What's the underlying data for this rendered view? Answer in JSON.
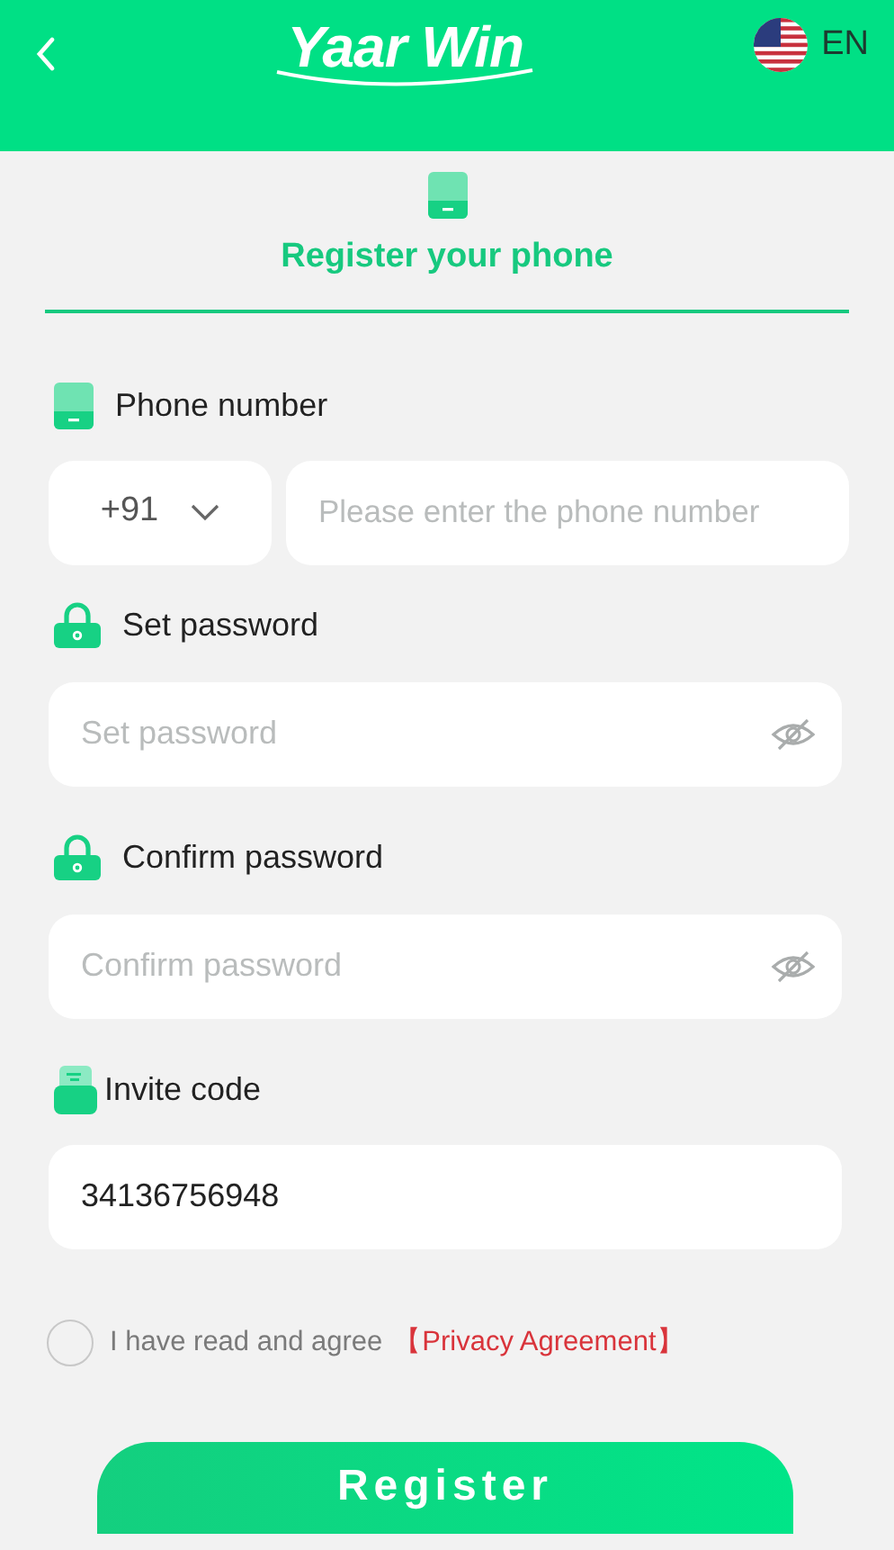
{
  "header": {
    "logo": "Yaar Win",
    "language": "EN"
  },
  "tab": {
    "label": "Register your phone",
    "selected": true
  },
  "fields": [
    {
      "kind": "phone",
      "label": "Phone number",
      "code": "+91",
      "placeholder": "Please enter the phone number"
    },
    {
      "kind": "password",
      "label": "Set password",
      "placeholder": "Set password"
    },
    {
      "kind": "password",
      "label": "Confirm password",
      "placeholder": "Confirm password"
    },
    {
      "kind": "text",
      "label": "Invite code",
      "value": "34136756948"
    }
  ],
  "agreement": {
    "checked": false,
    "text": "I have read and agree",
    "link": "【Privacy Agreement】"
  },
  "submit": "Register"
}
